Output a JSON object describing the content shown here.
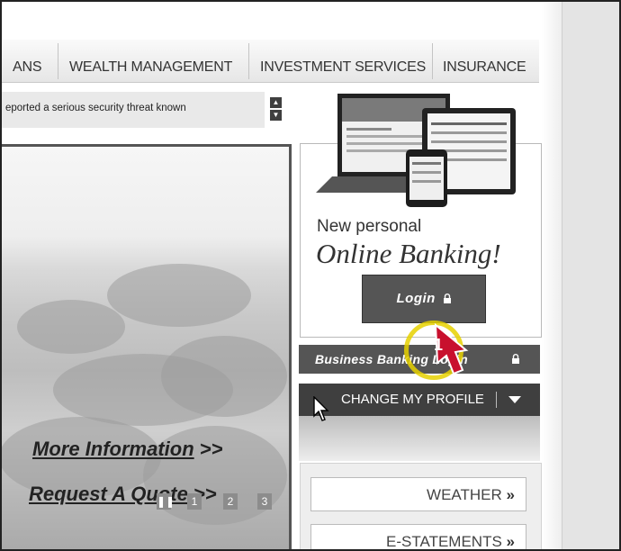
{
  "nav": {
    "items": [
      "ANS",
      "WEALTH MANAGEMENT",
      "INVESTMENT SERVICES",
      "INSURANCE"
    ]
  },
  "ticker": {
    "text": "eported a serious security threat known",
    "up_icon": "arrow-up-icon",
    "down_icon": "arrow-down-icon"
  },
  "hero": {
    "links": [
      {
        "label": "More Information",
        "suffix": " >>"
      },
      {
        "label": "Request A Quote",
        "suffix": " >>"
      }
    ],
    "controls": {
      "pause_icon": "pause-icon",
      "pages": [
        "1",
        "2",
        "3"
      ]
    }
  },
  "online_banking": {
    "tagline_small": "New personal",
    "tagline_big": "Online Banking!",
    "login_label": "Login",
    "lock_icon": "lock-icon"
  },
  "business_banking": {
    "label": "Business Banking Login"
  },
  "profile": {
    "label": "CHANGE MY PROFILE",
    "dropdown_icon": "chevron-down-icon"
  },
  "quick_links": [
    {
      "label": "WEATHER",
      "chevron": "»"
    },
    {
      "label": "E-STATEMENTS",
      "chevron": "»"
    }
  ],
  "annotation": {
    "step": "1"
  },
  "colors": {
    "dark_button": "#555555",
    "profile_bar": "#3f3f3f",
    "highlight_ring": "#e6d100",
    "step_arrow": "#c8102e"
  }
}
